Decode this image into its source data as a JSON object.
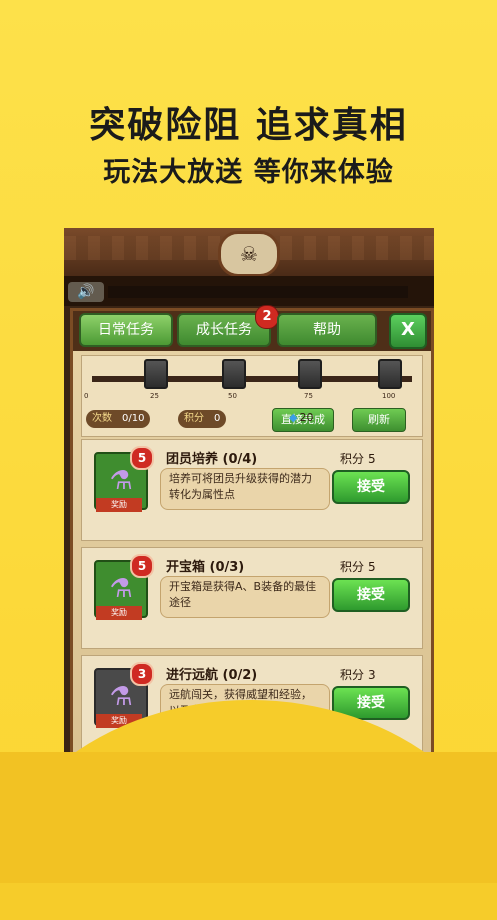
{
  "hero": {
    "line1": "突破险阻 追求真相",
    "line2": "玩法大放送 等你来体验"
  },
  "ui": {
    "sound_icon": "speaker-icon",
    "tabs": [
      {
        "label": "日常任务",
        "badge": ""
      },
      {
        "label": "成长任务",
        "badge": "2"
      },
      {
        "label": "帮助",
        "badge": ""
      }
    ],
    "close_label": "X",
    "progress": {
      "ticks": [
        "0",
        "25",
        "50",
        "75",
        "100"
      ],
      "count_label": "次数",
      "count_value": "0/10",
      "points_label": "积分",
      "points_value": "0",
      "finish_label": "直接完成",
      "refresh_label": "刷新",
      "gem_value": "20"
    },
    "tasks": [
      {
        "title": "团员培养 (0/4)",
        "level": "5",
        "desc": "培养可将团员升级获得的潜力转化为属性点",
        "score_label": "积分",
        "score_value": "5",
        "button": "接受",
        "reward": "奖励"
      },
      {
        "title": "开宝箱 (0/3)",
        "level": "5",
        "desc": "开宝箱是获得A、B装备的最佳途径",
        "score_label": "积分",
        "score_value": "5",
        "button": "接受",
        "reward": "奖励"
      },
      {
        "title": "进行远航 (0/2)",
        "level": "3",
        "desc": "远航闯关，获得威望和经验，以及各种道具",
        "score_label": "积分",
        "score_value": "3",
        "button": "接受",
        "reward": "奖励"
      }
    ]
  }
}
